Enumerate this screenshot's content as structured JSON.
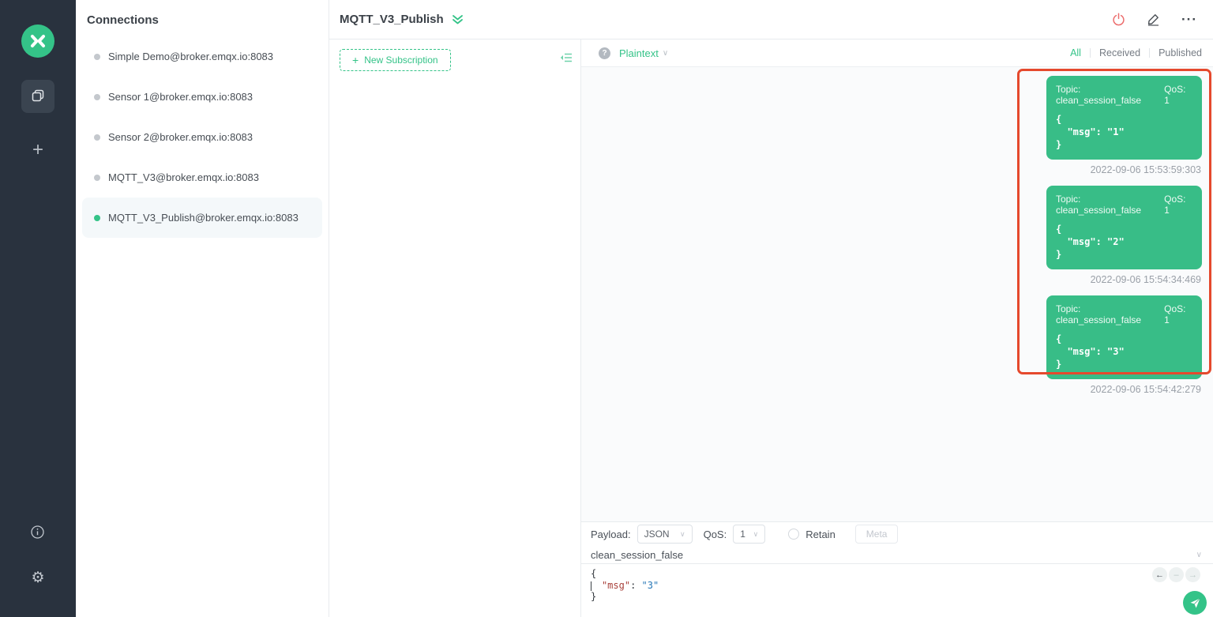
{
  "icons": {
    "plus": "+",
    "chevron_down": "∨",
    "more_horizontal": "···",
    "gear": "⚙",
    "question_mark": "?",
    "arrow_left": "←",
    "dash": "–",
    "arrow_right": "→"
  },
  "colors": {
    "accent_green": "#34c388",
    "bubble_green": "#38bd87",
    "annotation_red": "#e5492d",
    "rail_bg": "#29323e"
  },
  "connections": {
    "title": "Connections",
    "items": [
      {
        "label": "Simple Demo@broker.emqx.io:8083",
        "status": "offline"
      },
      {
        "label": "Sensor 1@broker.emqx.io:8083",
        "status": "offline"
      },
      {
        "label": "Sensor 2@broker.emqx.io:8083",
        "status": "offline"
      },
      {
        "label": "MQTT_V3@broker.emqx.io:8083",
        "status": "offline"
      },
      {
        "label": "MQTT_V3_Publish@broker.emqx.io:8083",
        "status": "connected",
        "selected": true
      }
    ]
  },
  "header": {
    "title": "MQTT_V3_Publish"
  },
  "subscriptions": {
    "new_subscription_label": "New Subscription"
  },
  "messages_toolbar": {
    "view_mode": "Plaintext",
    "filters": {
      "all": "All",
      "received": "Received",
      "published": "Published"
    },
    "active_filter": "All"
  },
  "messages": [
    {
      "topic_label": "Topic: clean_session_false",
      "qos_label": "QoS: 1",
      "payload": "{\n  \"msg\": \"1\"\n}",
      "timestamp": "2022-09-06 15:53:59:303"
    },
    {
      "topic_label": "Topic: clean_session_false",
      "qos_label": "QoS: 1",
      "payload": "{\n  \"msg\": \"2\"\n}",
      "timestamp": "2022-09-06 15:54:34:469"
    },
    {
      "topic_label": "Topic: clean_session_false",
      "qos_label": "QoS: 1",
      "payload": "{\n  \"msg\": \"3\"\n}",
      "timestamp": "2022-09-06 15:54:42:279"
    }
  ],
  "publish": {
    "payload_label": "Payload:",
    "payload_type": "JSON",
    "qos_label": "QoS:",
    "qos_value": "1",
    "retain_label": "Retain",
    "meta_label": "Meta",
    "topic": "clean_session_false",
    "editor": {
      "open_brace": "{",
      "indent": "  ",
      "key": "\"msg\"",
      "colon": ": ",
      "value": "\"3\"",
      "close_brace": "}"
    }
  }
}
